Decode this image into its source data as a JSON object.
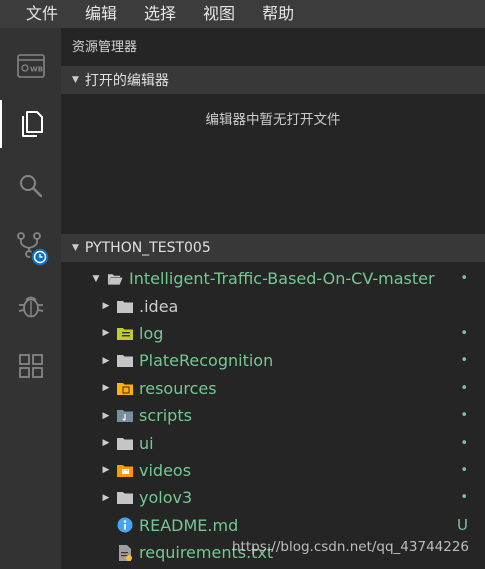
{
  "menu": [
    "文件",
    "编辑",
    "选择",
    "视图",
    "帮助"
  ],
  "sidebar": {
    "title": "资源管理器",
    "open_editors": {
      "label": "打开的编辑器",
      "empty_message": "编辑器中暂无打开文件"
    },
    "workspace": {
      "label": "PYTHON_TEST005"
    }
  },
  "tree": [
    {
      "label": "Intelligent-Traffic-Based-On-CV-master",
      "icon": "folder-open-icon",
      "decoration": "•",
      "color": "green"
    },
    {
      "label": ".idea",
      "icon": "folder-icon",
      "decoration": "",
      "color": "white"
    },
    {
      "label": "log",
      "icon": "log-folder-icon",
      "decoration": "•",
      "color": "green"
    },
    {
      "label": "PlateRecognition",
      "icon": "folder-icon",
      "decoration": "•",
      "color": "green"
    },
    {
      "label": "resources",
      "icon": "resources-folder-icon",
      "decoration": "•",
      "color": "green"
    },
    {
      "label": "scripts",
      "icon": "scripts-folder-icon",
      "decoration": "•",
      "color": "green"
    },
    {
      "label": "ui",
      "icon": "folder-icon",
      "decoration": "•",
      "color": "green"
    },
    {
      "label": "videos",
      "icon": "videos-folder-icon",
      "decoration": "•",
      "color": "green"
    },
    {
      "label": "yolov3",
      "icon": "folder-icon",
      "decoration": "•",
      "color": "green"
    },
    {
      "label": "README.md",
      "icon": "info-icon",
      "decoration": "U",
      "color": "green"
    },
    {
      "label": "requirements.txt",
      "icon": "text-file-icon",
      "decoration": "",
      "color": "green"
    }
  ],
  "watermark": "https://blog.csdn.net/qq_43744226",
  "colors": {
    "accent_green": "#73c991",
    "activity_bar": "#333333",
    "sidebar": "#252526",
    "badge": "#0e70c0"
  }
}
